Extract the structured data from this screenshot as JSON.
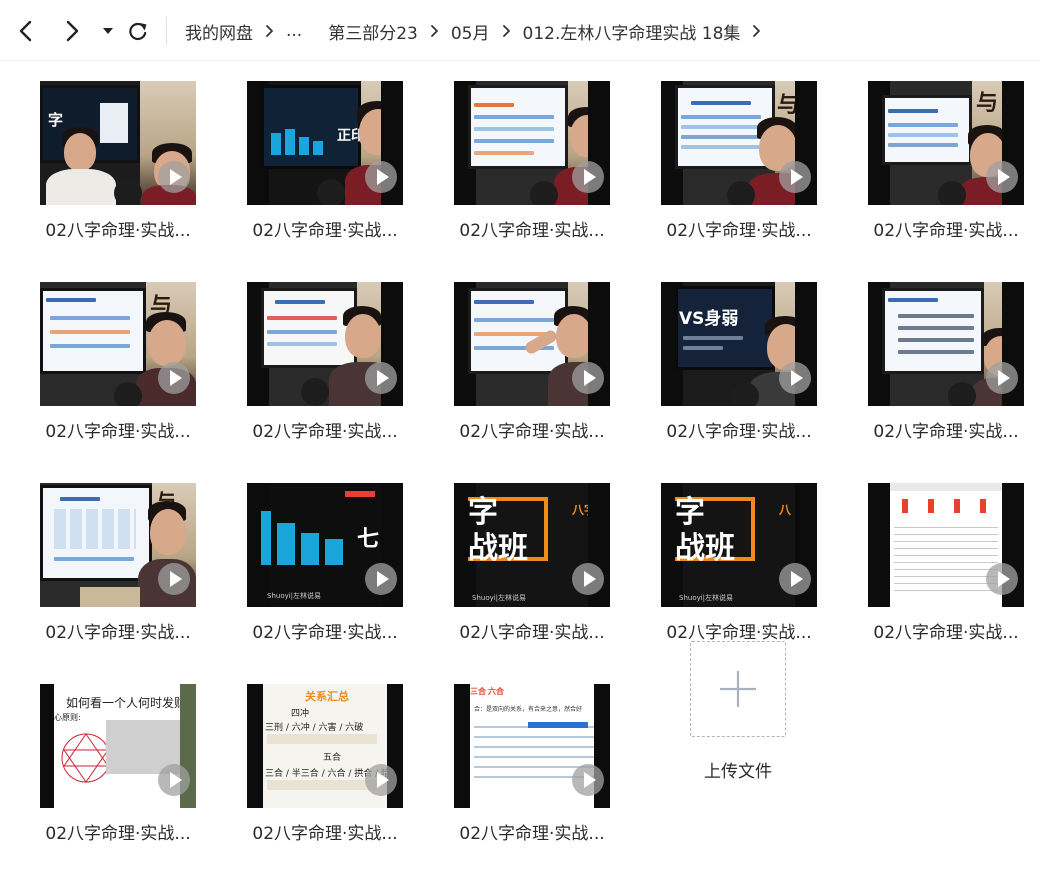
{
  "nav": {
    "back_icon": "chevron-left-icon",
    "forward_icon": "chevron-right-icon",
    "dropdown_icon": "caret-down-icon",
    "refresh_icon": "refresh-icon"
  },
  "breadcrumb": [
    "我的网盘",
    "...",
    "第三部分23",
    "05月",
    "012.左林八字命理实战 18集"
  ],
  "files": [
    {
      "name": "02八字命理·实战..."
    },
    {
      "name": "02八字命理·实战..."
    },
    {
      "name": "02八字命理·实战..."
    },
    {
      "name": "02八字命理·实战..."
    },
    {
      "name": "02八字命理·实战..."
    },
    {
      "name": "02八字命理·实战..."
    },
    {
      "name": "02八字命理·实战..."
    },
    {
      "name": "02八字命理·实战..."
    },
    {
      "name": "02八字命理·实战..."
    },
    {
      "name": "02八字命理·实战..."
    },
    {
      "name": "02八字命理·实战..."
    },
    {
      "name": "02八字命理·实战..."
    },
    {
      "name": "02八字命理·实战..."
    },
    {
      "name": "02八字命理·实战..."
    },
    {
      "name": "02八字命理·实战..."
    },
    {
      "name": "02八字命理·实战..."
    },
    {
      "name": "02八字命理·实战..."
    },
    {
      "name": "02八字命理·实战..."
    }
  ],
  "thumb_text": {
    "t2_word": "正印",
    "t9_word": "VS身弱",
    "t12_word": "七",
    "t13_big": "字",
    "t13_big2": "战班",
    "t13_side": "八字",
    "t13_brand": "Shuoyi|左林说易",
    "t16_title": "如何看一个人何时发财",
    "t16_sub": "心原则:",
    "t17_title": "关系汇总",
    "t17_a": "四冲",
    "t17_b": "三刑 / 六冲 / 六害 / 六破",
    "t17_c": "五合",
    "t17_d": "三合 / 半三合 / 六合 / 拱合 / 暗",
    "t18_tab": "六合",
    "t18_tab0": "三合",
    "t18_line": "合：是双向的关系，有合来之意，然合好",
    "t12_brand": "Shuoyi|左林说易",
    "t14_brand": "Shuoyi|左林说易"
  },
  "upload": {
    "label": "上传文件",
    "icon": "plus-icon"
  },
  "colors": {
    "accent_orange": "#f08a1c",
    "cyan_bar": "#1aa6dc",
    "red_title": "#e8412c"
  }
}
